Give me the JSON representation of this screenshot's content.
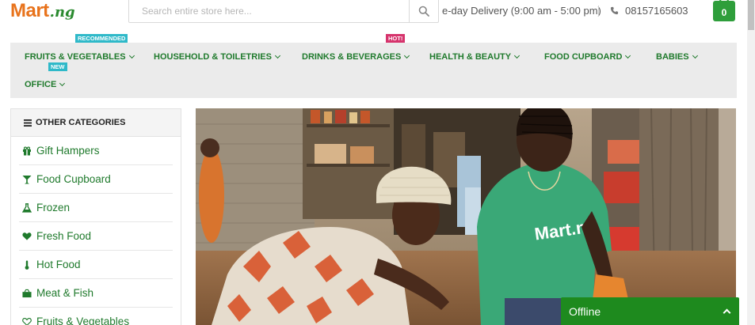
{
  "header": {
    "logo_main": "Mart",
    "logo_sub": ".ng",
    "search_placeholder": "Search entire store here...",
    "delivery_text": "e-day Delivery (9:00 am - 5:00 pm)",
    "phone": "08157165603",
    "cart_count": "0"
  },
  "nav": {
    "items": [
      {
        "label": "FRUITS & VEGETABLES"
      },
      {
        "label": "HOUSEHOLD & TOILETRIES"
      },
      {
        "label": "DRINKS & BEVERAGES"
      },
      {
        "label": "HEALTH & BEAUTY"
      },
      {
        "label": "FOOD CUPBOARD"
      },
      {
        "label": "BABIES"
      },
      {
        "label": "OFFICE"
      }
    ],
    "badges": {
      "recommended": "RECOMMENDED",
      "hot": "HOT!",
      "new": "NEW"
    },
    "badge_colors": {
      "recommended": "#2fb9c9",
      "hot": "#d6336c",
      "new": "#2fb9c9"
    }
  },
  "sidebar": {
    "title": "OTHER CATEGORIES",
    "items": [
      {
        "label": "Gift Hampers",
        "icon": "gift-icon"
      },
      {
        "label": "Food Cupboard",
        "icon": "glass-icon"
      },
      {
        "label": "Frozen",
        "icon": "flask-icon"
      },
      {
        "label": "Fresh Food",
        "icon": "heart-icon"
      },
      {
        "label": "Hot Food",
        "icon": "thermometer-icon"
      },
      {
        "label": "Meat & Fish",
        "icon": "shopping-bag-icon"
      },
      {
        "label": "Fruits & Vegetables",
        "icon": "heart-outline-icon"
      }
    ]
  },
  "hero": {
    "shirt_logo": "Mart.ng"
  },
  "chat": {
    "status": "Offline"
  },
  "colors": {
    "brand_green": "#1f7a2c",
    "brand_orange": "#e8731c",
    "chat_green": "#1e8a1e",
    "cart_green": "#2e9e3b"
  }
}
